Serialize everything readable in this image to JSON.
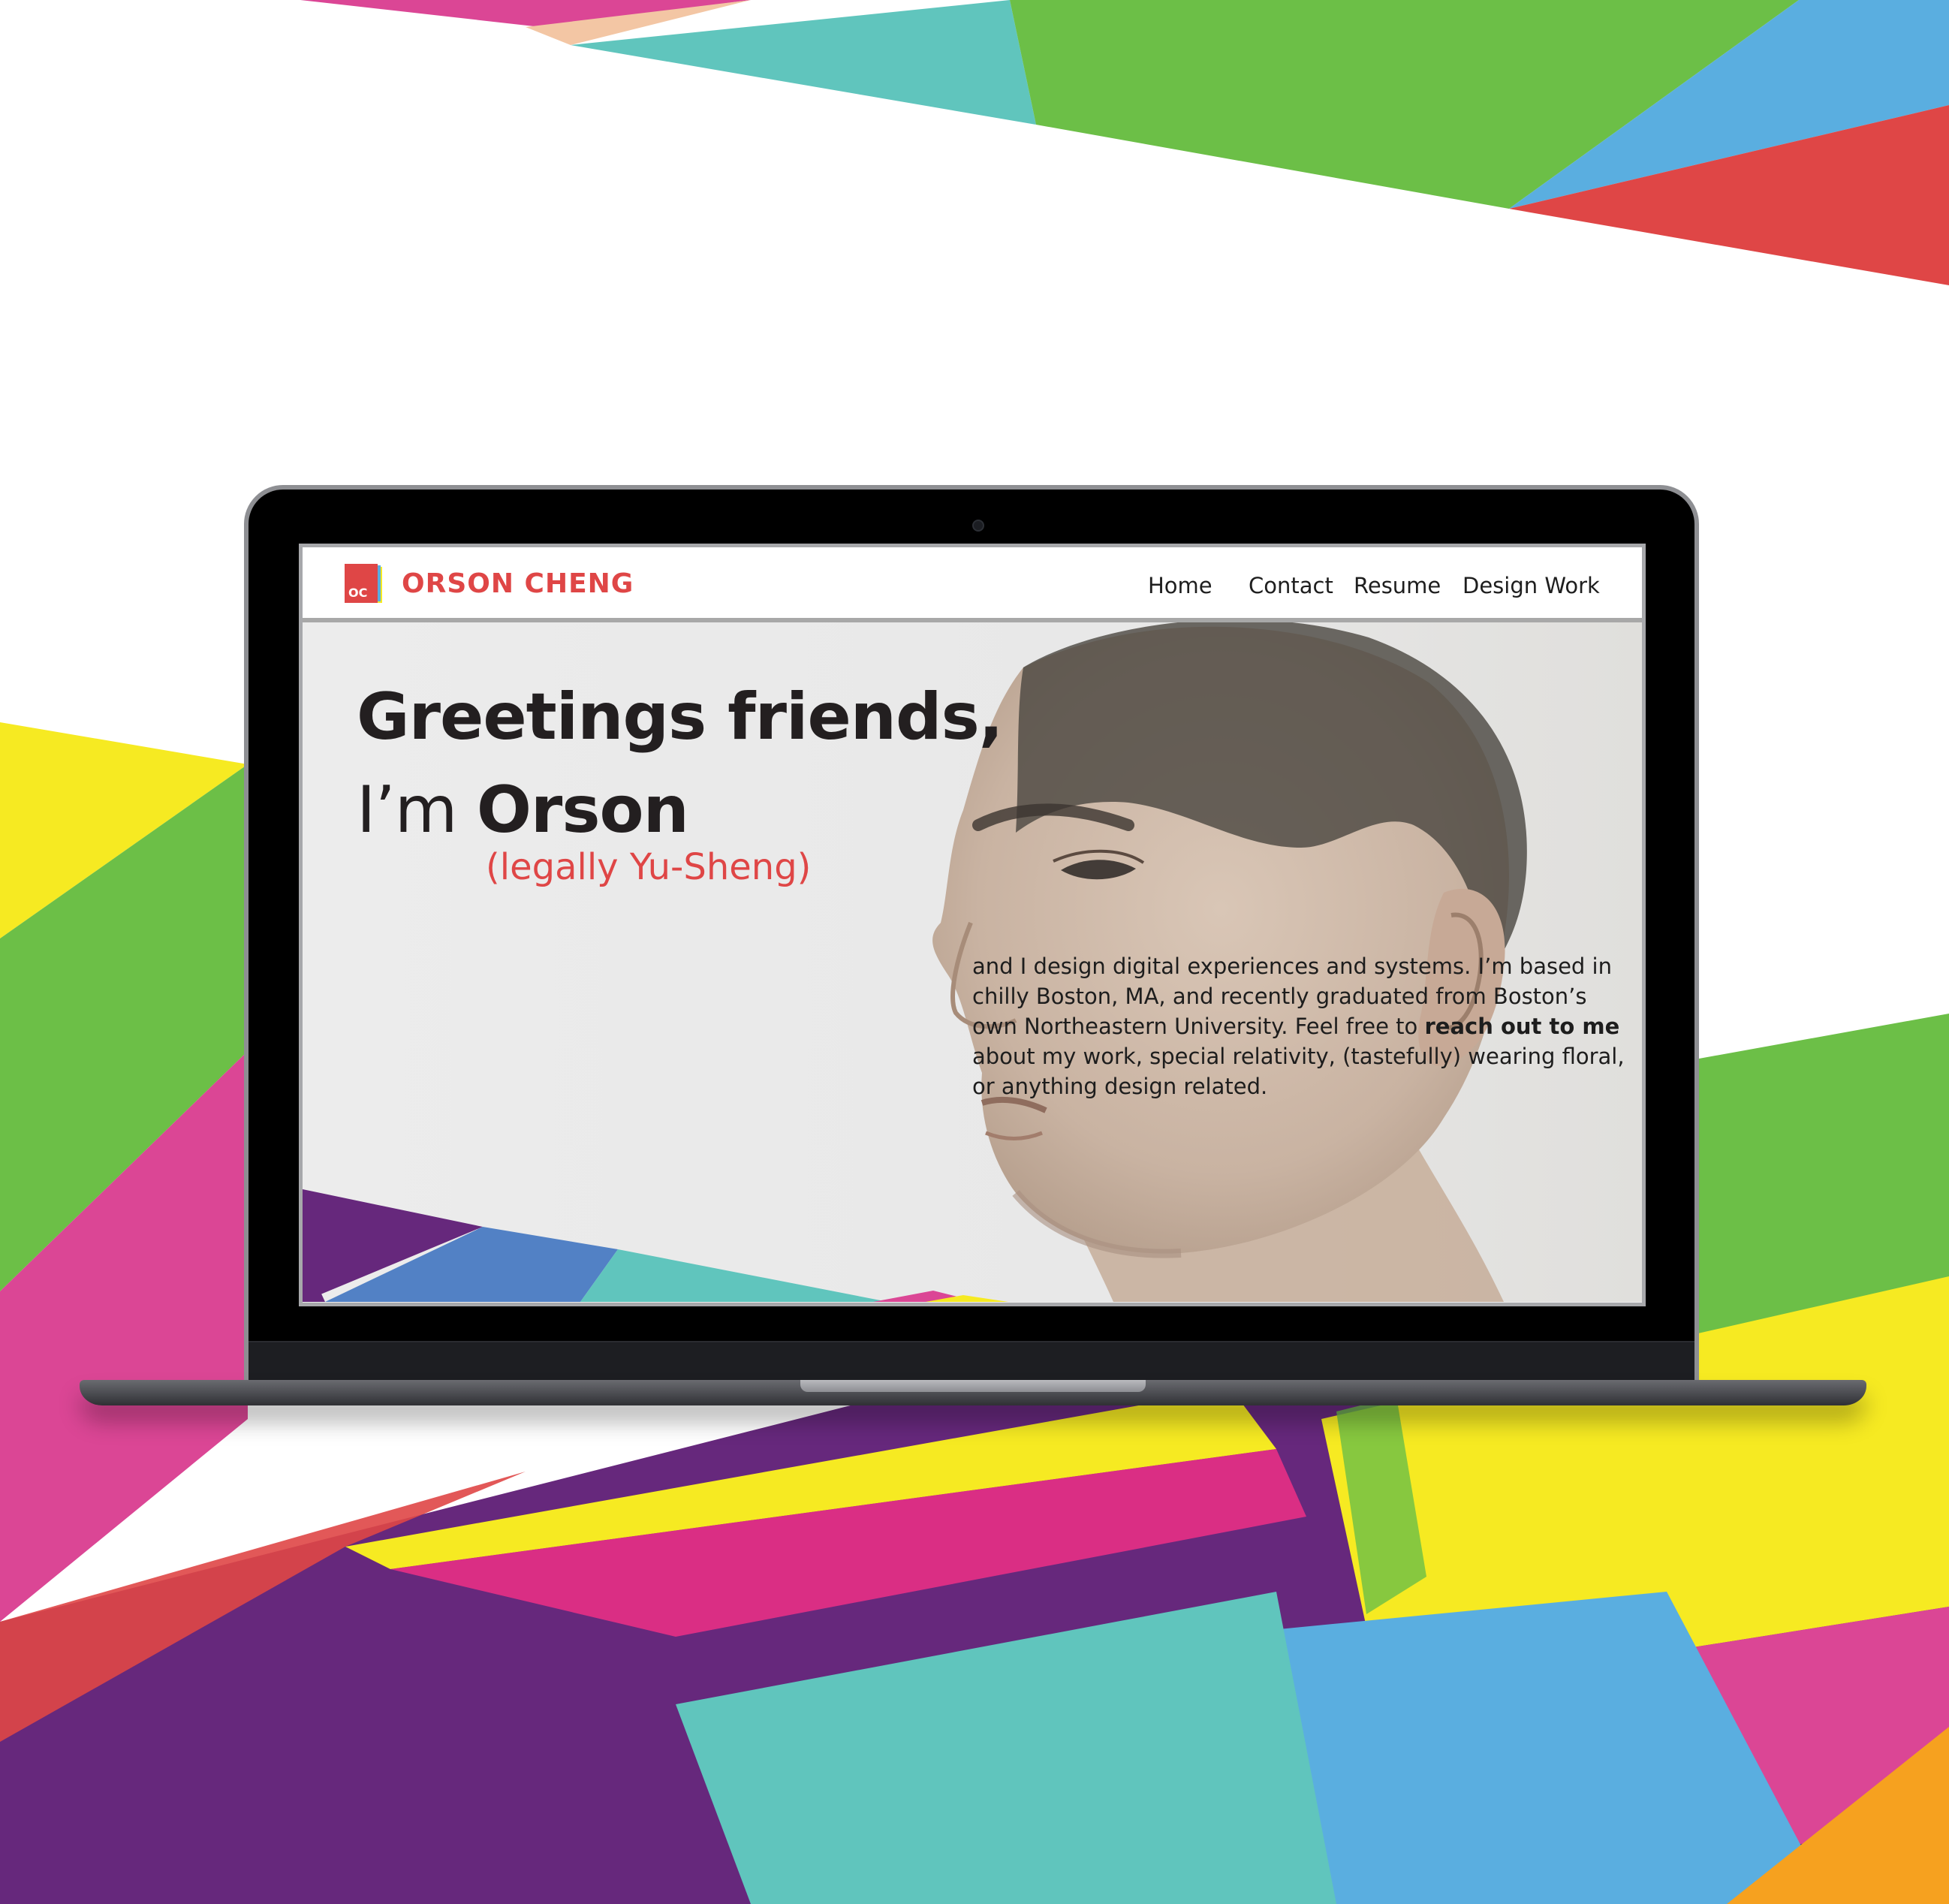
{
  "brand": {
    "logo_initials": "OC",
    "name": "ORSON CHENG",
    "color": "#df4646"
  },
  "nav": {
    "home": "Home",
    "contact": "Contact",
    "resume": "Resume",
    "design_work": "Design Work"
  },
  "hero": {
    "headline_line1": "Greetings friends,",
    "headline_prefix": "I’m ",
    "headline_name": "Orson",
    "legal_name": "(legally Yu-Sheng)",
    "bio_part1": "and I design digital experiences and systems. I’m based in chilly Boston, MA, and recently graduated from Boston’s own Northeastern University. Feel free to ",
    "bio_link": "reach out to me",
    "bio_part2": " about my work, special relativity, (tastefully) wearing floral, or anything design related."
  },
  "palette": {
    "pink": "#db4695",
    "green": "#6cbf47",
    "teal": "#60c5bd",
    "blue": "#5aaee0",
    "red": "#df4646",
    "yellow": "#f6ea22",
    "purple": "#66287c",
    "orange": "#f6a11f"
  }
}
